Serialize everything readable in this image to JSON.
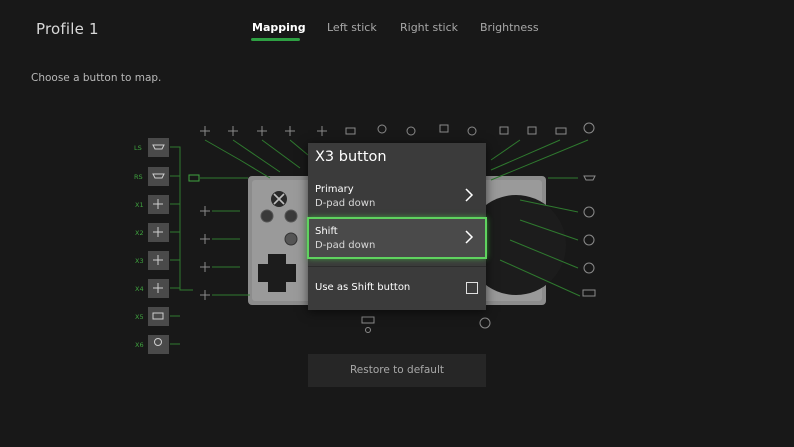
{
  "header": {
    "profile_title": "Profile 1",
    "tabs": [
      {
        "label": "Mapping",
        "active": true
      },
      {
        "label": "Left stick",
        "active": false
      },
      {
        "label": "Right stick",
        "active": false
      },
      {
        "label": "Brightness",
        "active": false
      }
    ]
  },
  "instructions": "Choose a button to map.",
  "diagram": {
    "left_port_labels": [
      "LS",
      "RS",
      "X1",
      "X2",
      "X3",
      "X4",
      "X5",
      "X6"
    ],
    "accent_color": "#3fa33f",
    "icons": [
      "controller-icon",
      "dpad-icon",
      "bumper-icon",
      "trigger-icon",
      "a-button-icon",
      "b-button-icon",
      "x-button-icon",
      "y-button-icon",
      "view-icon",
      "menu-icon",
      "guide-icon"
    ]
  },
  "dialog": {
    "title": "X3 button",
    "primary": {
      "label": "Primary",
      "value": "D-pad down"
    },
    "shift": {
      "label": "Shift",
      "value": "D-pad down"
    },
    "shift_toggle": {
      "label": "Use as Shift button",
      "checked": false
    }
  },
  "restore_button": "Restore to default",
  "colors": {
    "background": "#181818",
    "focus": "#5fd35f",
    "dialog": "#3b3b3b"
  }
}
